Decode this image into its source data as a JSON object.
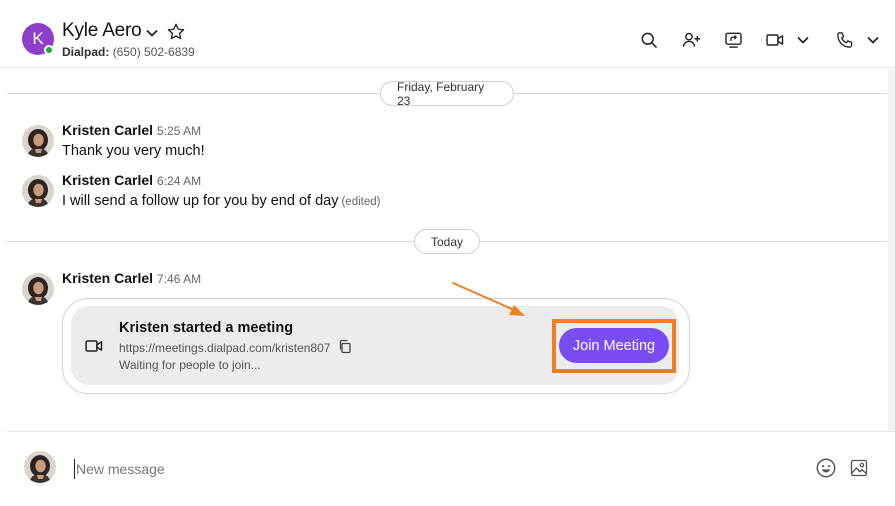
{
  "header": {
    "avatar_letter": "K",
    "contact_name": "Kyle Aero",
    "line_label": "Dialpad:",
    "phone": "(650) 502-6839",
    "icons": [
      "search-icon",
      "add-person-icon",
      "share-screen-icon",
      "video-icon",
      "phone-icon"
    ]
  },
  "dividers": {
    "first_date": "Friday, February 23",
    "second_date": "Today"
  },
  "messages": [
    {
      "sender": "Kristen Carlel",
      "time": "5:25 AM",
      "text": "Thank you very much!"
    },
    {
      "sender": "Kristen Carlel",
      "time": "6:24 AM",
      "text": "I will send a follow up for you by end of day",
      "edited": "(edited)"
    },
    {
      "sender": "Kristen Carlel",
      "time": "7:46 AM"
    }
  ],
  "meeting_card": {
    "title": "Kristen started a meeting",
    "link": "https://meetings.dialpad.com/kristen807",
    "status": "Waiting for people to join...",
    "join_label": "Join Meeting"
  },
  "composer": {
    "placeholder": "New message"
  },
  "colors": {
    "accent": "#7a4df2",
    "highlight": "#f07f22",
    "avatar_purple": "#8e3fc9",
    "presence_green": "#1fa83b"
  }
}
